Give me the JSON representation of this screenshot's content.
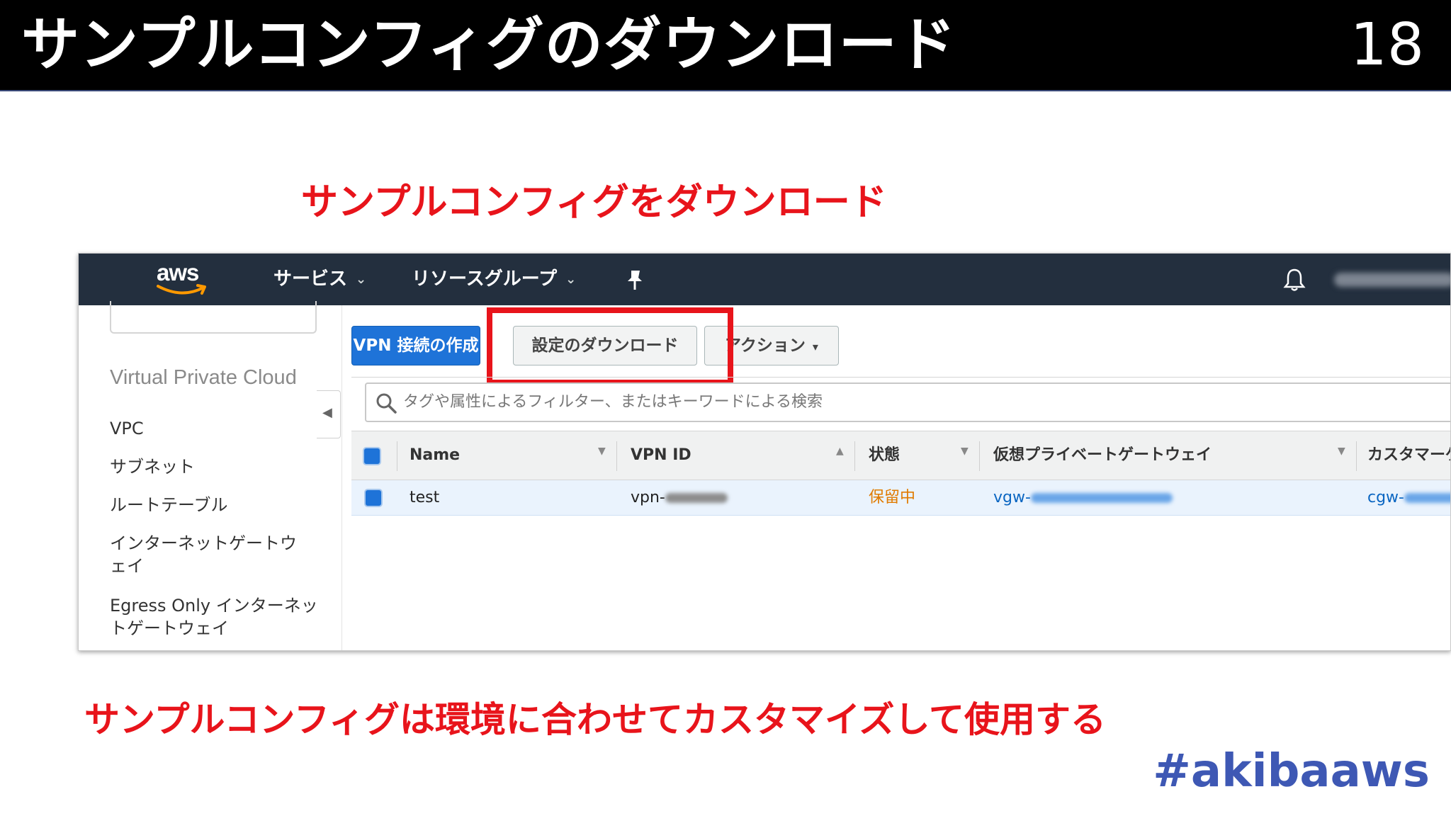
{
  "slide": {
    "title": "サンプルコンフィグのダウンロード",
    "page_number": "18",
    "caption_top": "サンプルコンフィグをダウンロード",
    "caption_bottom": "サンプルコンフィグは環境に合わせてカスタマイズして使用する",
    "hashtag": "#akibaaws"
  },
  "console": {
    "nav": {
      "logo": "aws",
      "services": "サービス",
      "resource_groups": "リソースグループ",
      "icons": [
        "pin-icon",
        "bell-icon"
      ]
    },
    "sidebar": {
      "heading": "Virtual Private Cloud",
      "items": [
        "VPC",
        "サブネット",
        "ルートテーブル",
        "インターネットゲートウェイ",
        "Egress Only インターネットゲートウェイ"
      ]
    },
    "toolbar": {
      "create_vpn": "VPN 接続の作成",
      "download_config": "設定のダウンロード",
      "actions": "アクション"
    },
    "search": {
      "placeholder": "タグや属性によるフィルター、またはキーワードによる検索"
    },
    "table": {
      "columns": [
        "Name",
        "VPN ID",
        "状態",
        "仮想プライベートゲートウェイ",
        "カスタマーゲートウェ"
      ],
      "rows": [
        {
          "name": "test",
          "vpn_id_prefix": "vpn-",
          "state": "保留中",
          "vgw_prefix": "vgw-",
          "cgw_prefix": "cgw-"
        }
      ]
    },
    "colors": {
      "nav_bg": "#232f3e",
      "primary_button": "#1e73d8",
      "highlight": "#e8141b",
      "state_pending": "#e07b00",
      "link": "#0b66c2"
    }
  }
}
